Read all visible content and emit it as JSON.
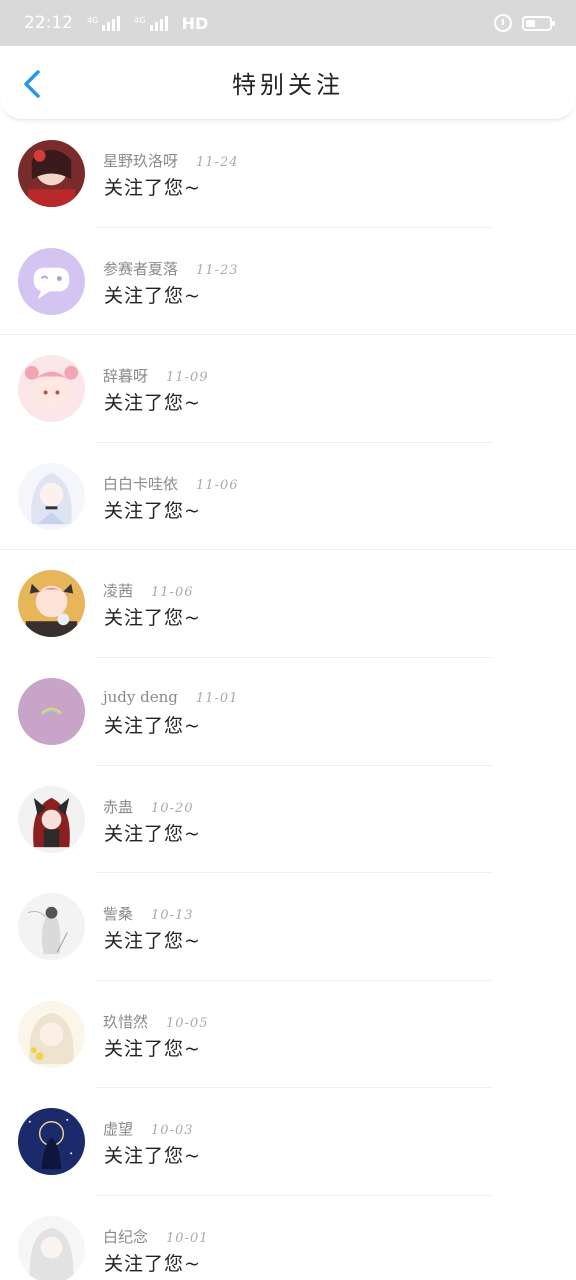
{
  "status_bar": {
    "time": "22:12",
    "network_label": "HD"
  },
  "header": {
    "title": "特别关注"
  },
  "notifications": [
    {
      "name": "星野玖洛呀",
      "date": "11-24",
      "message": "关注了您~"
    },
    {
      "name": "参赛者夏落",
      "date": "11-23",
      "message": "关注了您~"
    },
    {
      "name": "辞暮呀",
      "date": "11-09",
      "message": "关注了您~"
    },
    {
      "name": "白白卡哇依",
      "date": "11-06",
      "message": "关注了您~"
    },
    {
      "name": "凌茜",
      "date": "11-06",
      "message": "关注了您~"
    },
    {
      "name": "judy deng",
      "date": "11-01",
      "message": "关注了您~"
    },
    {
      "name": "赤蛊",
      "date": "10-20",
      "message": "关注了您~"
    },
    {
      "name": "訾桑",
      "date": "10-13",
      "message": "关注了您~"
    },
    {
      "name": "玖惜然",
      "date": "10-05",
      "message": "关注了您~"
    },
    {
      "name": "虚望",
      "date": "10-03",
      "message": "关注了您~"
    },
    {
      "name": "白纪念",
      "date": "10-01",
      "message": "关注了您~"
    }
  ],
  "colors": {
    "accent": "#2196f3",
    "status_bar": "#d9d9d9"
  },
  "icons": {
    "back": "chevron-left-icon",
    "alarm": "alarm-icon",
    "battery": "battery-icon"
  }
}
